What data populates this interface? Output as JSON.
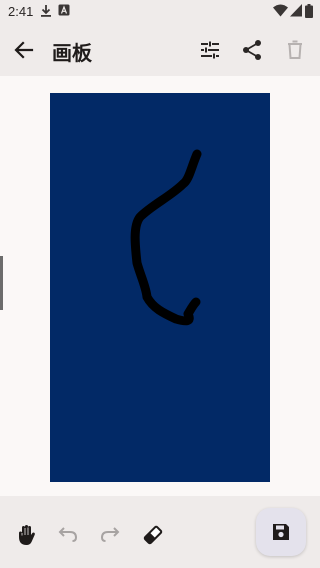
{
  "status_bar": {
    "time": "2:41",
    "icons": [
      "download-icon",
      "sim-a-icon",
      "wifi-icon",
      "signal-icon",
      "battery-icon"
    ]
  },
  "app_bar": {
    "title": "画板",
    "icons": [
      "back-arrow-icon",
      "tune-icon",
      "share-icon",
      "delete-icon"
    ]
  },
  "canvas": {
    "background_color": "#022966",
    "stroke_color": "#000000"
  },
  "toolbar": {
    "icons": [
      "hand-icon",
      "undo-icon",
      "redo-icon",
      "eraser-icon",
      "save-icon"
    ]
  }
}
